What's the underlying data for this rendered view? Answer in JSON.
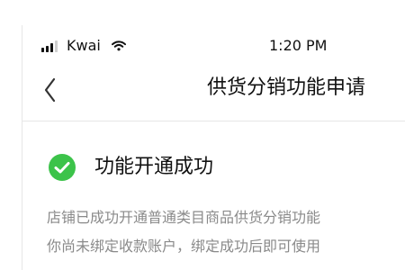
{
  "status_bar": {
    "carrier": "Kwai",
    "time": "1:20 PM",
    "icons": [
      "signal-bars",
      "wifi"
    ]
  },
  "nav": {
    "back_icon": "chevron-left",
    "title": "供货分销功能申请"
  },
  "success": {
    "icon": "check-circle",
    "title": "功能开通成功",
    "accent_color": "#3cc34a"
  },
  "description": {
    "line1": "店铺已成功开通普通类目商品供货分销功能",
    "line2": "你尚未绑定收款账户，绑定成功后即可使用"
  }
}
